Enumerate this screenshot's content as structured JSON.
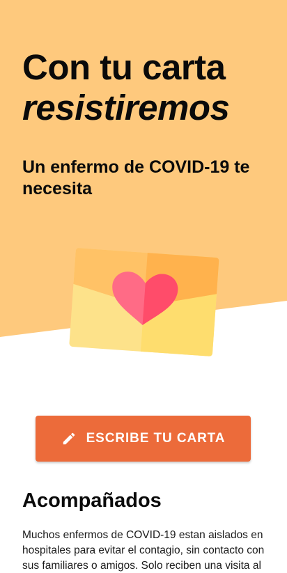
{
  "hero": {
    "title_line1": "Con tu carta",
    "title_line2": "resistiremos",
    "subtitle": "Un enfermo de COVID-19 te necesita",
    "background_color": "#fec97d",
    "illustration_icon": "envelope-heart-icon"
  },
  "cta": {
    "label": "ESCRIBE TU CARTA",
    "icon": "pencil-icon",
    "color": "#ec6b3a"
  },
  "section": {
    "title": "Acompañados",
    "body": "Muchos enfermos de COVID-19 estan aislados en hospitales para evitar el contagio, sin contacto con sus familiares o amigos. Solo reciben una visita al"
  }
}
